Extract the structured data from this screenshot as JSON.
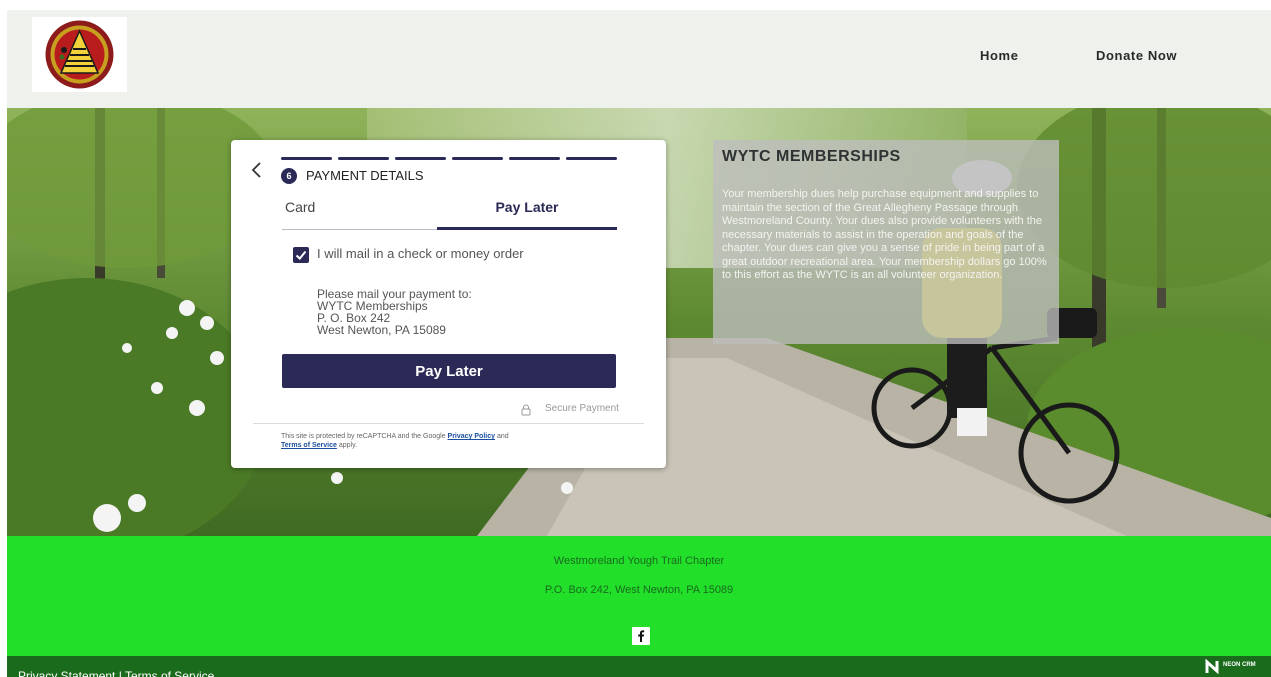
{
  "header": {
    "logo_text": "WESTMORELAND YOUGH TRAIL CHAPTER",
    "nav": {
      "home": "Home",
      "donate": "Donate Now"
    }
  },
  "payment": {
    "back_icon": "chevron-left-icon",
    "step_number": "6",
    "steps_total": 6,
    "steps_completed": 6,
    "step_title": "PAYMENT DETAILS",
    "tabs": {
      "card": "Card",
      "pay_later": "Pay Later"
    },
    "selected_tab": "Pay Later",
    "checkbox_label": "I will mail in a check or money order",
    "checkbox_checked": true,
    "mail_lines": [
      "Please mail your payment to:",
      "WYTC Memberships",
      "P. O. Box 242",
      "West Newton, PA 15089"
    ],
    "button_label": "Pay Later",
    "secure_label": "Secure Payment",
    "recaptcha": {
      "prefix": "This site is protected by reCAPTCHA and the Google ",
      "privacy": "Privacy Policy",
      "and": " and ",
      "terms": "Terms of Service",
      "suffix": " apply."
    }
  },
  "info": {
    "title": "WYTC MEMBERSHIPS",
    "body": "Your membership dues help purchase equipment and supplies to maintain the section of the Great Allegheny Passage through Westmoreland County.  Your dues also provide volunteers with the necessary materials to assist in the operation and goals of the chapter.  Your dues can give you a sense of pride in being part of a great outdoor recreational area.  Your membership dollars go 100% to this effort as the WYTC is an all volunteer organization."
  },
  "footer": {
    "org_name": "Westmoreland Yough Trail Chapter",
    "address": "P.O. Box 242, West Newton, PA  15089",
    "social_icon": "facebook-icon",
    "links": "Privacy Statement | Terms of Service",
    "powered_by": "NEON CRM"
  },
  "colors": {
    "brand_navy": "#2b2a57",
    "footer_green": "#22e02a",
    "bottom_bar_green": "#1a6b1c",
    "header_bg": "#eef1ec"
  }
}
